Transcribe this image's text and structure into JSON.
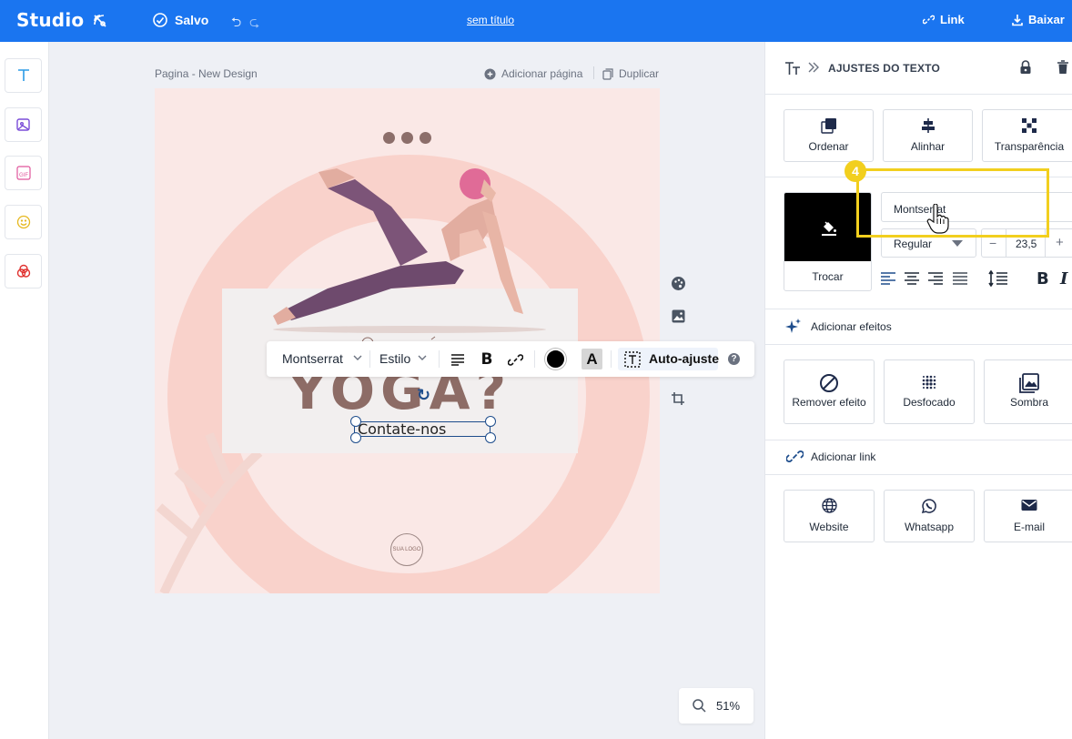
{
  "topbar": {
    "brand": "Studio",
    "saved": "Salvo",
    "title": "sem título",
    "link": "Link",
    "download": "Baixar"
  },
  "leftbar": {
    "tools": [
      "text-tool",
      "image-tool",
      "gif-tool",
      "sticker-tool",
      "color-tool"
    ]
  },
  "canvas_header": {
    "page_label": "Pagina - New Design",
    "add_page": "Adicionar página",
    "duplicate": "Duplicar"
  },
  "design": {
    "headline": "YOGA?",
    "cta": "Contate-nos",
    "logo": "SUA LOGO"
  },
  "text_toolbar": {
    "font": "Montserrat",
    "style": "Estilo",
    "auto_fit": "Auto-ajuste",
    "help": "?",
    "text_color": "#000000"
  },
  "zoom": {
    "value": "51%"
  },
  "panel": {
    "title": "AJUSTES DO TEXTO",
    "actions": [
      {
        "label": "Ordenar",
        "icon": "order-icon"
      },
      {
        "label": "Alinhar",
        "icon": "align-icon"
      },
      {
        "label": "Transparência",
        "icon": "transparency-icon"
      }
    ],
    "swap_label": "Trocar",
    "font_value": "Montserrat",
    "weight_value": "Regular",
    "size_value": "23,5",
    "effects_label": "Adicionar efeitos",
    "effects": [
      {
        "label": "Remover efeito",
        "icon": "remove-effect-icon"
      },
      {
        "label": "Desfocado",
        "icon": "blur-icon"
      },
      {
        "label": "Sombra",
        "icon": "shadow-icon"
      }
    ],
    "link_label": "Adicionar link",
    "links": [
      {
        "label": "Website",
        "icon": "globe-icon"
      },
      {
        "label": "Whatsapp",
        "icon": "whatsapp-icon"
      },
      {
        "label": "E-mail",
        "icon": "mail-icon"
      }
    ]
  },
  "annotation": {
    "step": "4"
  },
  "colors": {
    "topbar": "#1a75f0",
    "canvas_bg": "#fae8e6",
    "ring": "#f9d2cb",
    "headline": "#8d6c66",
    "callout": "#f2cf1e"
  }
}
